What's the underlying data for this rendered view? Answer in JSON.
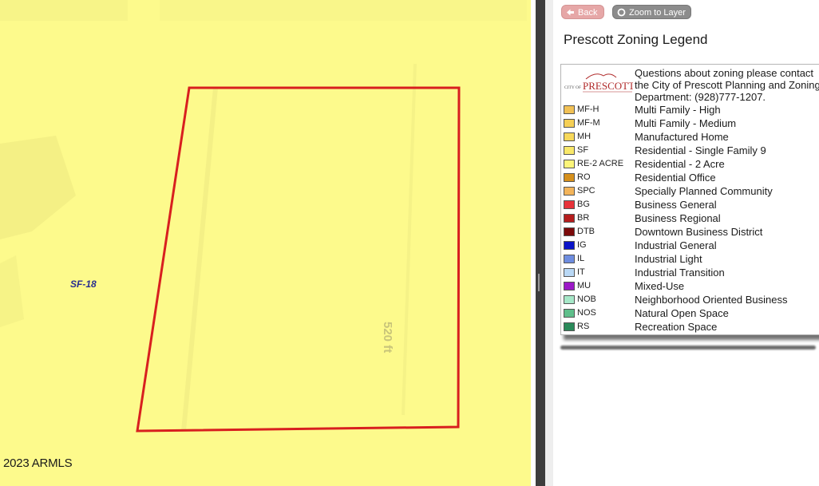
{
  "map": {
    "zone_label": "SF-18",
    "dimension_label": "520 ft",
    "copyright": "2023 ARMLS",
    "parcel_color": "#d81f1f",
    "fill_color": "#fdfa8c"
  },
  "toolbar": {
    "back_label": "Back",
    "back_icon": "arrow-left-icon",
    "zoom_label": "Zoom to Layer",
    "zoom_icon": "circle-icon"
  },
  "legend": {
    "title": "Prescott Zoning Legend",
    "logo_text": "CITY OF PRESCOTT",
    "contact_lines": [
      "Questions about zoning please contact",
      "the City of Prescott Planning and Zoning",
      "Department: (928)777-1207."
    ],
    "items": [
      {
        "code": "MF-H",
        "desc": "Multi Family - High",
        "color": "#f2c155"
      },
      {
        "code": "MF-M",
        "desc": "Multi Family - Medium",
        "color": "#f5cf55"
      },
      {
        "code": "MH",
        "desc": "Manufactured Home",
        "color": "#f7d85a"
      },
      {
        "code": "SF",
        "desc": "Residential - Single Family 9",
        "color": "#f9e86a"
      },
      {
        "code": "RE-2 ACRE",
        "desc": "Residential - 2 Acre",
        "color": "#fcf57a"
      },
      {
        "code": "RO",
        "desc": "Residential Office",
        "color": "#d6901c"
      },
      {
        "code": "SPC",
        "desc": "Specially Planned Community",
        "color": "#f3b45a"
      },
      {
        "code": "BG",
        "desc": "Business General",
        "color": "#e8333a"
      },
      {
        "code": "BR",
        "desc": "Business Regional",
        "color": "#b51d1d"
      },
      {
        "code": "DTB",
        "desc": "Downtown Business District",
        "color": "#7c0a0a"
      },
      {
        "code": "IG",
        "desc": "Industrial General",
        "color": "#0a14c8"
      },
      {
        "code": "IL",
        "desc": "Industrial Light",
        "color": "#6e8de0"
      },
      {
        "code": "IT",
        "desc": "Industrial Transition",
        "color": "#b9d8f5"
      },
      {
        "code": "MU",
        "desc": "Mixed-Use",
        "color": "#9b18c7"
      },
      {
        "code": "NOB",
        "desc": "Neighborhood Oriented Business",
        "color": "#a6e8c8"
      },
      {
        "code": "NOS",
        "desc": "Natural Open Space",
        "color": "#5fbf8b"
      },
      {
        "code": "RS",
        "desc": "Recreation Space",
        "color": "#2a8a5a"
      }
    ]
  }
}
